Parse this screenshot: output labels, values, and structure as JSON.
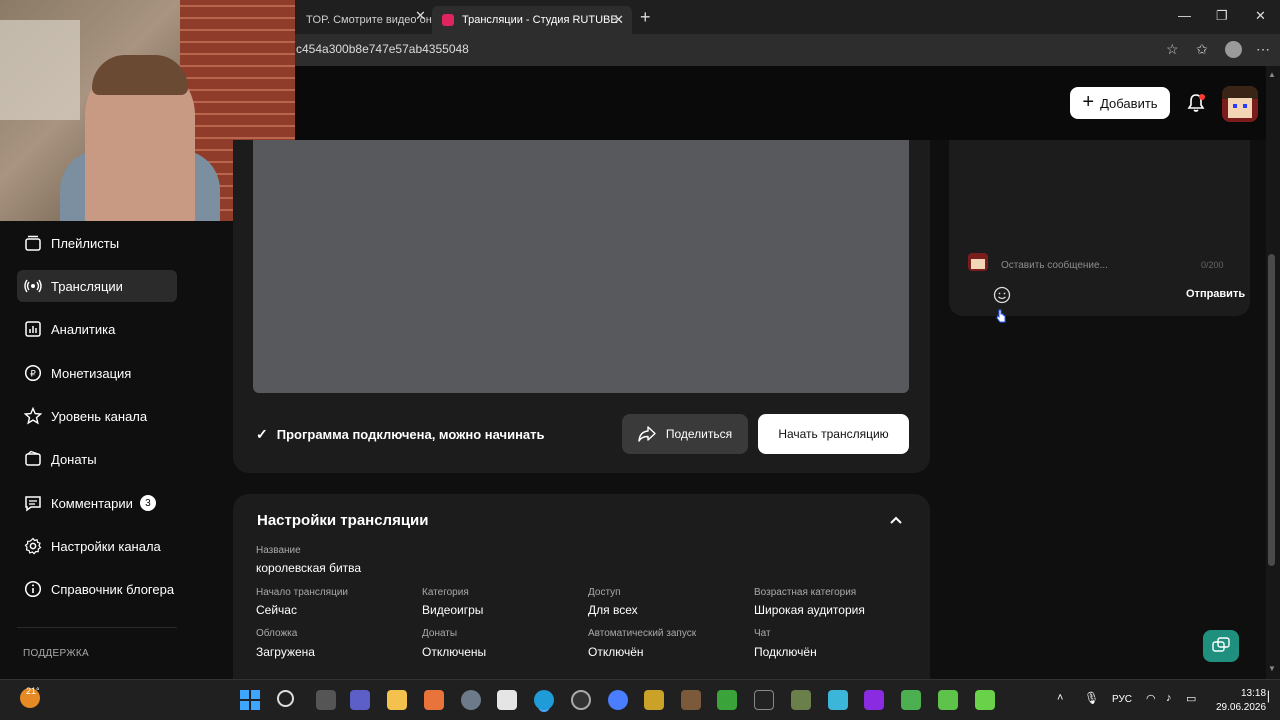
{
  "browser": {
    "tabs": [
      {
        "title": "TOP. Смотрите видео он",
        "active": false
      },
      {
        "title": "Трансляции - Студия RUTUBE",
        "active": true
      }
    ],
    "url": "c454a300b8e747e57ab4355048"
  },
  "header": {
    "add_label": "Добавить"
  },
  "sidebar": {
    "items": [
      {
        "label": "Плейлисты",
        "icon": "playlist-icon",
        "active": false
      },
      {
        "label": "Трансляции",
        "icon": "broadcast-icon",
        "active": true
      },
      {
        "label": "Аналитика",
        "icon": "chart-icon",
        "active": false
      },
      {
        "label": "Монетизация",
        "icon": "ruble-icon",
        "active": false
      },
      {
        "label": "Уровень канала",
        "icon": "star-icon",
        "active": false
      },
      {
        "label": "Донаты",
        "icon": "donate-icon",
        "active": false
      },
      {
        "label": "Комментарии",
        "icon": "comment-icon",
        "active": false,
        "badge": "3"
      },
      {
        "label": "Настройки канала",
        "icon": "gear-icon",
        "active": false
      },
      {
        "label": "Справочник блогера",
        "icon": "info-icon",
        "active": false
      }
    ],
    "support_label": "ПОДДЕРЖКА"
  },
  "stream": {
    "status_text": "Программа подключена, можно начинать",
    "share_label": "Поделиться",
    "start_label": "Начать трансляцию"
  },
  "settings": {
    "title": "Настройки трансляции",
    "name_label": "Название",
    "name_value": "королевская битва",
    "fields": [
      {
        "label": "Начало трансляции",
        "value": "Сейчас"
      },
      {
        "label": "Категория",
        "value": "Видеоигры"
      },
      {
        "label": "Доступ",
        "value": "Для всех"
      },
      {
        "label": "Возрастная категория",
        "value": "Широкая аудитория"
      },
      {
        "label": "Обложка",
        "value": "Загружена"
      },
      {
        "label": "Донаты",
        "value": "Отключены"
      },
      {
        "label": "Автоматический запуск",
        "value": "Отключён"
      },
      {
        "label": "Чат",
        "value": "Подключён"
      }
    ]
  },
  "chat": {
    "placeholder": "Оставить сообщение...",
    "counter": "0/200",
    "send_label": "Отправить"
  },
  "taskbar": {
    "temperature": "21°",
    "lang": "РУС",
    "time": "13:18",
    "date": "29.06.2026"
  },
  "colors": {
    "accent": "#1f8f7e",
    "background": "#0f0f0f",
    "card": "#1c1c1c"
  }
}
